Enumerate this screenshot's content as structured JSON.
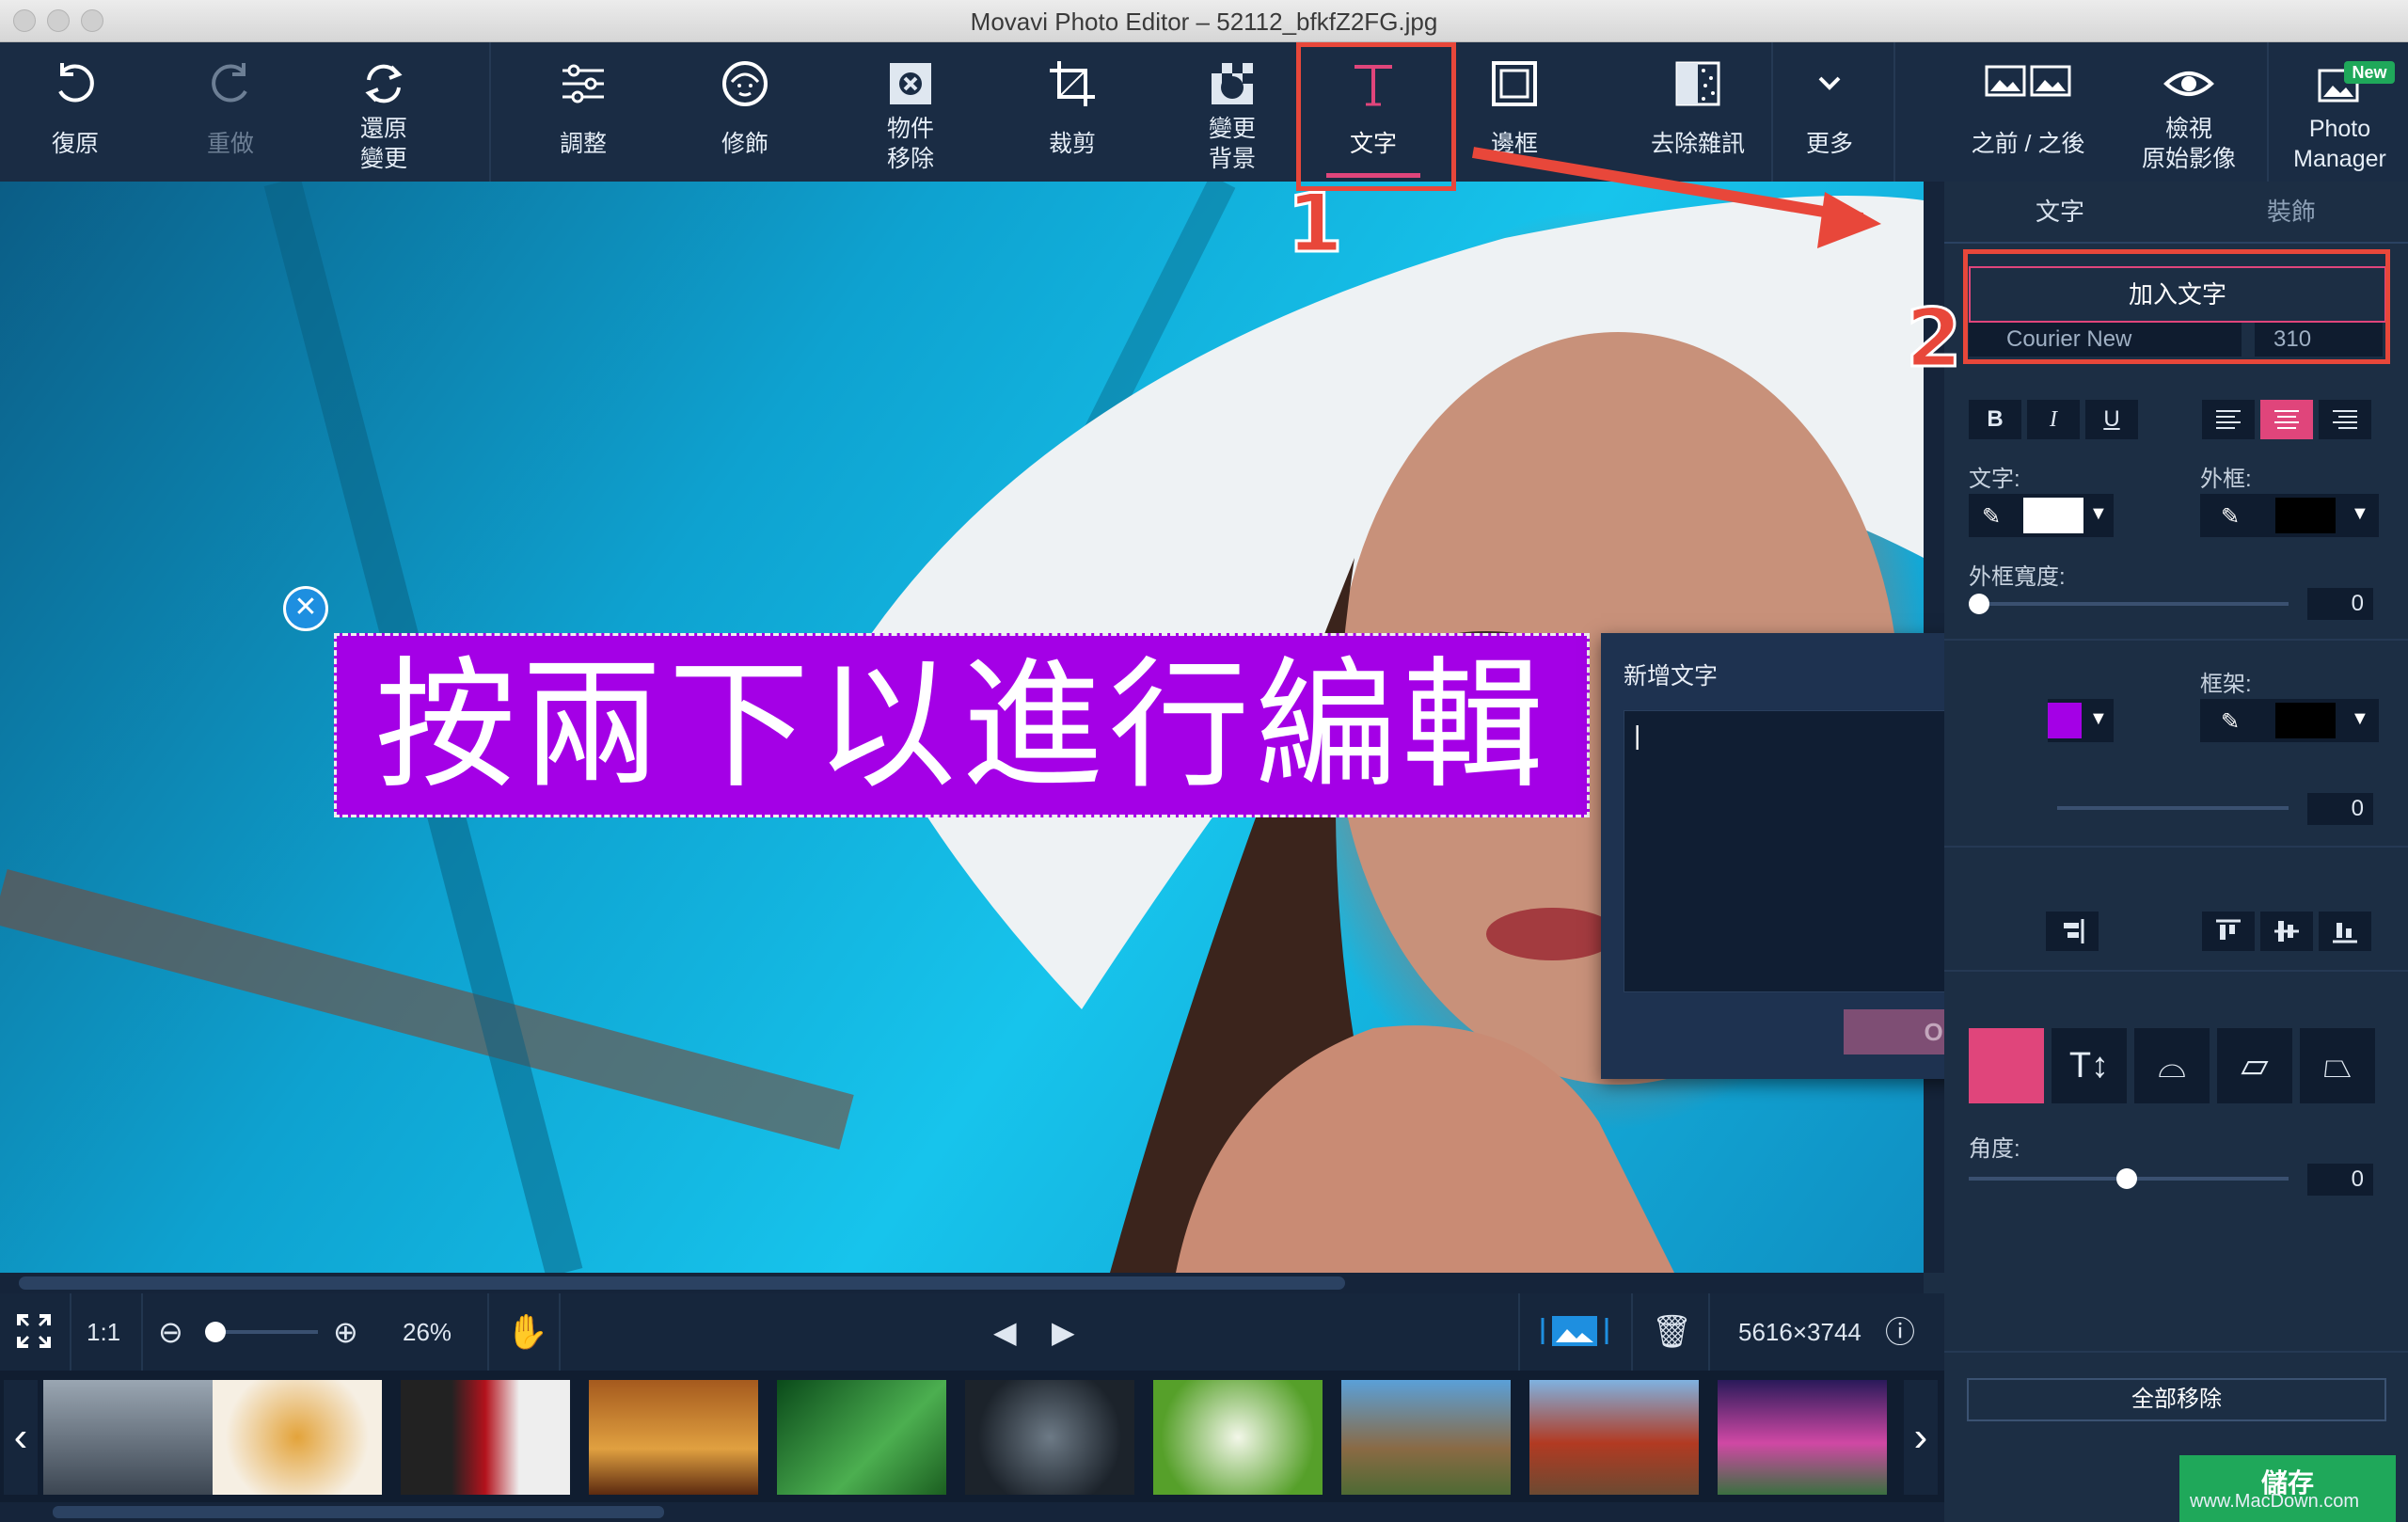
{
  "window": {
    "title": "Movavi Photo Editor – 52112_bfkfZ2FG.jpg"
  },
  "toolbar": {
    "undo": "復原",
    "redo": "重做",
    "restore_line1": "還原",
    "restore_line2": "變更",
    "adjust": "調整",
    "retouch": "修飾",
    "object_removal_line1": "物件",
    "object_removal_line2": "移除",
    "crop": "裁剪",
    "change_bg_line1": "變更",
    "change_bg_line2": "背景",
    "text": "文字",
    "frames": "邊框",
    "denoise": "去除雜訊",
    "more": "更多",
    "before_after": "之前 / 之後",
    "view_original_line1": "檢視",
    "view_original_line2": "原始影像",
    "photo_manager_line1": "Photo",
    "photo_manager_line2": "Manager",
    "new_badge": "New"
  },
  "canvas": {
    "overlay_text": "按兩下以進行編輯"
  },
  "dialog": {
    "title": "新增文字",
    "input_value": "|",
    "ok_label": "OK"
  },
  "panel": {
    "tab_text": "文字",
    "tab_decor": "裝飾",
    "add_text_button": "加入文字",
    "font_name": "Courier New",
    "font_size": "310",
    "bold": "B",
    "italic": "I",
    "underline": "U",
    "text_color_label": "文字:",
    "outline_label": "外框:",
    "outline_width_label": "外框寬度:",
    "outline_width_value": "0",
    "frame_label": "框架:",
    "frame_value": "0",
    "angle_label": "角度:",
    "angle_value": "0",
    "remove_all": "全部移除",
    "save": "儲存"
  },
  "bottombar": {
    "zoom_ratio": "1:1",
    "zoom_percent": "26%",
    "dimensions": "5616×3744"
  },
  "annotations": {
    "step1": "1",
    "step2": "2"
  },
  "watermark": "www.MacDown.com",
  "colors": {
    "accent_pink": "#e0457b",
    "annotation_red": "#e8473a",
    "overlay_bg": "#a400e6",
    "save_green": "#1fa85a"
  }
}
